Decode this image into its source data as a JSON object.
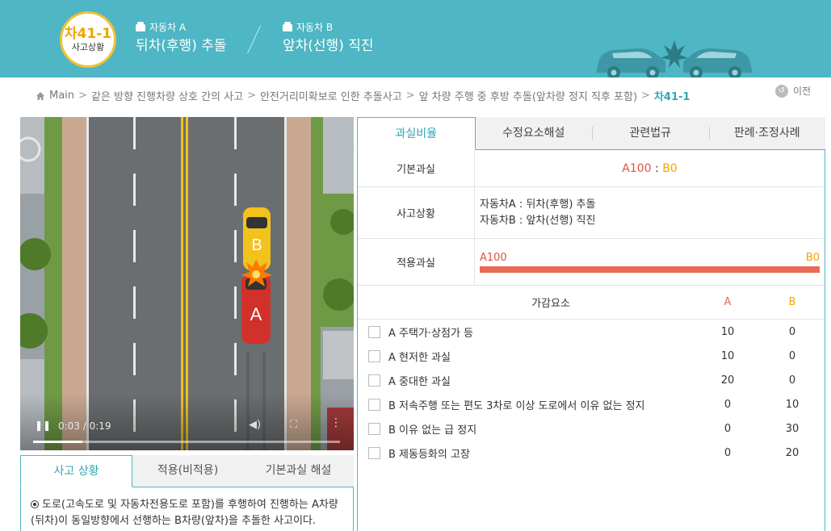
{
  "header": {
    "badge_code": "차41-1",
    "badge_sub": "사고상황",
    "car_a_label": "자동차 A",
    "car_a_desc": "뒤차(후행) 추돌",
    "car_b_label": "자동차 B",
    "car_b_desc": "앞차(선행) 직진"
  },
  "breadcrumb": {
    "items": [
      "Main",
      "같은 방향 진행차량 상호 간의 사고",
      "안전거리미확보로 인한 추돌사고",
      "앞 차량 주행 중 후방 추돌(앞차량 정지 직후 포함)"
    ],
    "current": "차41-1",
    "separator": ">"
  },
  "prev_label": "이전",
  "video": {
    "time": "0:03 / 0:19",
    "progress": 0.16,
    "car_a": "A",
    "car_b": "B"
  },
  "bottom_tabs": [
    "사고 상황",
    "적용(비적용)",
    "기본과실 해설"
  ],
  "bottom_text": "도로(고속도로 및 자동차전용도로 포함)를 후행하여 진행하는 A차량(뒤차)이 동일방향에서 선행하는 B차량(앞차)을 추돌한 사고이다.",
  "right_tabs": [
    "과실비율",
    "수정요소해설",
    "관련법규",
    "판례·조정사례"
  ],
  "info": {
    "basic_label": "기본과실",
    "basic_a": "A100",
    "basic_sep": " : ",
    "basic_b": "B0",
    "situation_label": "사고상황",
    "situation_a": "자동차A : 뒤차(후행) 추돌",
    "situation_b": "자동차B : 앞차(선행) 직진",
    "applied_label": "적용과실",
    "applied_a": "A100",
    "applied_b": "B0",
    "applied_a_share": 1.0
  },
  "factors": {
    "header": "가감요소",
    "col_a": "A",
    "col_b": "B",
    "rows": [
      {
        "name": "A 주택가·상점가 등",
        "a": "10",
        "b": "0"
      },
      {
        "name": "A 현저한 과실",
        "a": "10",
        "b": "0"
      },
      {
        "name": "A 중대한 과실",
        "a": "20",
        "b": "0"
      },
      {
        "name": "B 저속주행 또는 편도 3차로 이상 도로에서 이유 없는 정지",
        "a": "0",
        "b": "10"
      },
      {
        "name": "B 이유 없는 급 정지",
        "a": "0",
        "b": "30"
      },
      {
        "name": "B 제동등화의 고장",
        "a": "0",
        "b": "20"
      }
    ]
  },
  "colors": {
    "header_bg": "#4eb6c4",
    "accent": "#2fa6b5",
    "car_a": "#d2302a",
    "car_b": "#f2c21d",
    "bar": "#e86a54"
  }
}
